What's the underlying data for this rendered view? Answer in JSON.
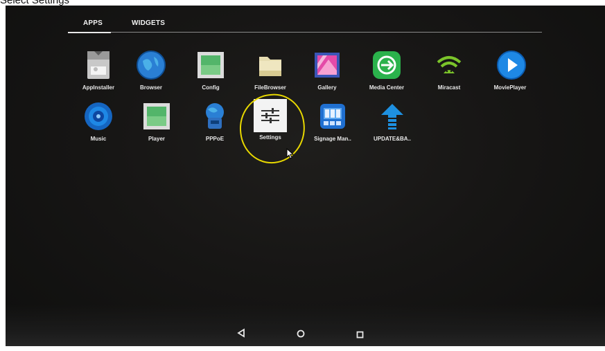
{
  "caption": "Select Settings",
  "tabs": {
    "apps": "APPS",
    "widgets": "WIDGETS"
  },
  "apps_row1": [
    {
      "label": "AppInstaller",
      "icon": "appinstaller-icon"
    },
    {
      "label": "Browser",
      "icon": "globe-icon"
    },
    {
      "label": "Config",
      "icon": "config-icon"
    },
    {
      "label": "FileBrowser",
      "icon": "folder-icon"
    },
    {
      "label": "Gallery",
      "icon": "gallery-icon"
    },
    {
      "label": "Media Center",
      "icon": "media-center-icon"
    },
    {
      "label": "Miracast",
      "icon": "miracast-icon"
    },
    {
      "label": "MoviePlayer",
      "icon": "play-icon"
    }
  ],
  "apps_row2": [
    {
      "label": "Music",
      "icon": "speaker-icon"
    },
    {
      "label": "Player",
      "icon": "player-icon"
    },
    {
      "label": "PPPoE",
      "icon": "pppoe-icon"
    },
    {
      "label": "Settings",
      "icon": "sliders-icon"
    },
    {
      "label": "Signage Man..",
      "icon": "signage-icon"
    },
    {
      "label": "UPDATE&BA..",
      "icon": "update-arrow-icon"
    }
  ],
  "navbar": {
    "back": "back",
    "home": "home",
    "recents": "recents"
  },
  "colors": {
    "highlight": "#e8d800",
    "background": "#161514"
  }
}
